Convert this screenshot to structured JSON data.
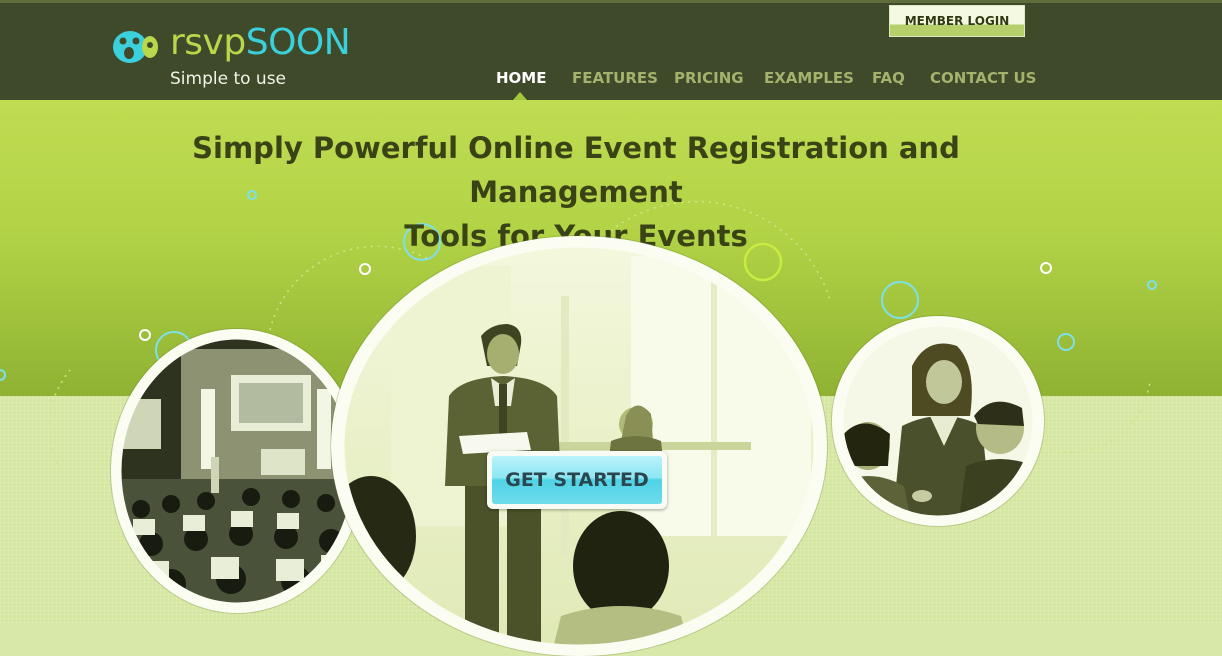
{
  "brand": {
    "name_part1": "rsvp",
    "name_part2": "SOON",
    "tagline": "Simple to use",
    "colors": {
      "green": "#b7d84a",
      "cyan": "#3ad0dc"
    }
  },
  "header": {
    "member_login": "MEMBER LOGIN",
    "nav": [
      {
        "label": "HOME",
        "active": true
      },
      {
        "label": "FEATURES",
        "active": false
      },
      {
        "label": "PRICING",
        "active": false
      },
      {
        "label": "EXAMPLES",
        "active": false
      },
      {
        "label": "FAQ",
        "active": false
      },
      {
        "label": "CONTACT US",
        "active": false
      }
    ]
  },
  "hero": {
    "headline_line1": "Simply Powerful Online Event Registration and Management",
    "headline_line2": "Tools for Your Events",
    "cta_label": "GET STARTED",
    "images": [
      "conference-audience-photo",
      "presenter-photo",
      "business-team-photo"
    ]
  },
  "colors": {
    "header_bg": "#3f4a2a",
    "hero_green": "#b2d346",
    "cta_cyan": "#4fd3e6",
    "nav_active": "#ffffff",
    "nav_inactive": "#a4b26d"
  }
}
